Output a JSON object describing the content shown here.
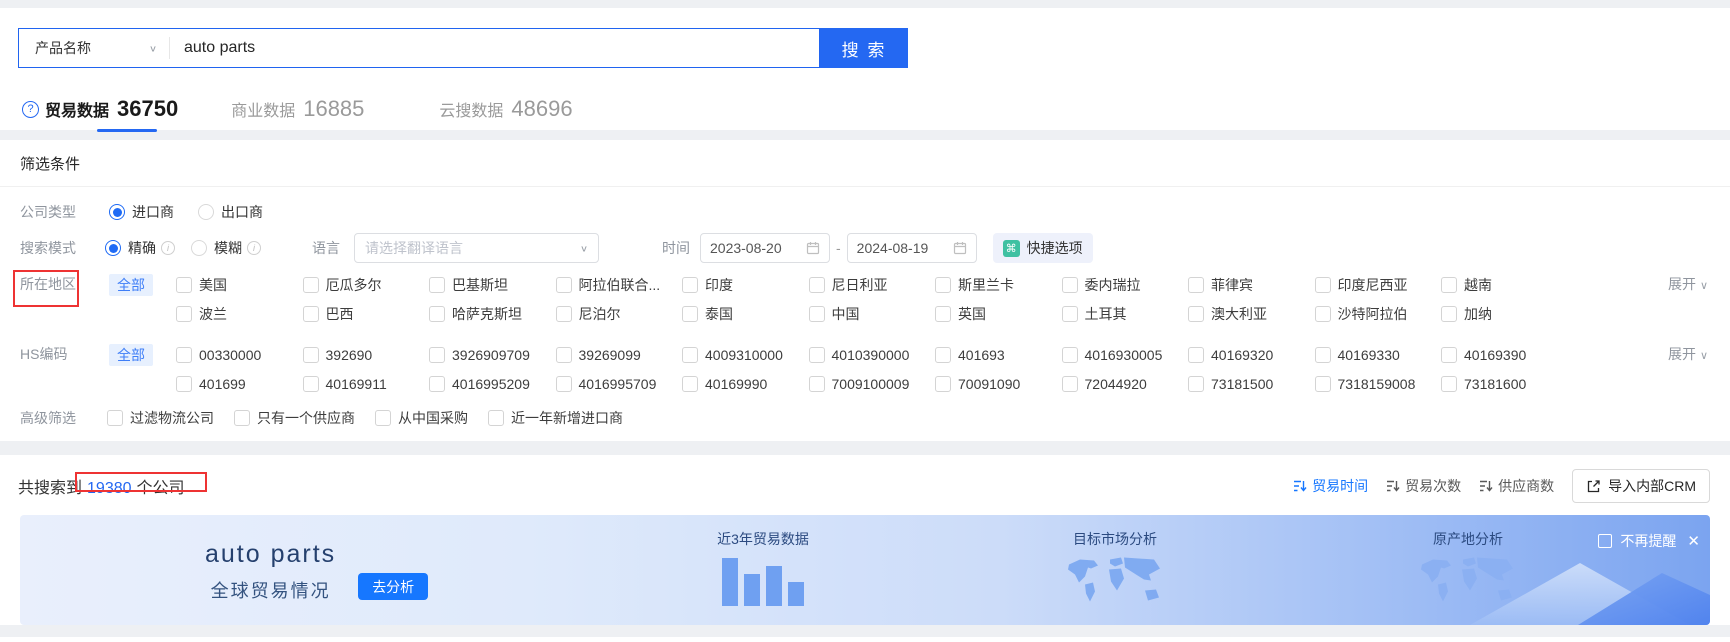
{
  "icons": {
    "help": "?",
    "chevron": "∨",
    "info": "i",
    "command": "⌘",
    "dash": "-",
    "close": "✕"
  },
  "search": {
    "category": "产品名称",
    "query": "auto parts",
    "button": "搜 索"
  },
  "tabs": [
    {
      "label": "贸易数据",
      "count": "36750"
    },
    {
      "label": "商业数据",
      "count": "16885"
    },
    {
      "label": "云搜数据",
      "count": "48696"
    }
  ],
  "filters": {
    "title": "筛选条件",
    "company_type": {
      "label": "公司类型",
      "options": [
        "进口商",
        "出口商"
      ],
      "selected": "进口商"
    },
    "search_mode": {
      "label": "搜索模式",
      "options": [
        "精确",
        "模糊"
      ],
      "selected": "精确"
    },
    "language": {
      "label": "语言",
      "placeholder": "请选择翻译语言"
    },
    "time": {
      "label": "时间",
      "start": "2023-08-20",
      "end": "2024-08-19"
    },
    "quick_option": "快捷选项",
    "region": {
      "label": "所在地区",
      "all": "全部",
      "expand": "展开",
      "row1": [
        "美国",
        "厄瓜多尔",
        "巴基斯坦",
        "阿拉伯联合...",
        "印度",
        "尼日利亚",
        "斯里兰卡",
        "委内瑞拉",
        "菲律宾",
        "印度尼西亚",
        "越南"
      ],
      "row2": [
        "波兰",
        "巴西",
        "哈萨克斯坦",
        "尼泊尔",
        "泰国",
        "中国",
        "英国",
        "土耳其",
        "澳大利亚",
        "沙特阿拉伯",
        "加纳"
      ]
    },
    "hs_code": {
      "label": "HS编码",
      "all": "全部",
      "expand": "展开",
      "row1": [
        "00330000",
        "392690",
        "3926909709",
        "39269099",
        "4009310000",
        "4010390000",
        "401693",
        "4016930005",
        "40169320",
        "40169330",
        "40169390"
      ],
      "row2": [
        "401699",
        "40169911",
        "4016995209",
        "4016995709",
        "40169990",
        "7009100009",
        "70091090",
        "72044920",
        "73181500",
        "7318159008",
        "73181600"
      ]
    },
    "advanced": {
      "label": "高级筛选",
      "options": [
        "过滤物流公司",
        "只有一个供应商",
        "从中国采购",
        "近一年新增进口商"
      ]
    }
  },
  "results": {
    "prefix": "共搜索到",
    "count": "19380",
    "suffix": "个公司",
    "sorts": [
      {
        "label": "贸易时间",
        "active": true
      },
      {
        "label": "贸易次数",
        "active": false
      },
      {
        "label": "供应商数",
        "active": false
      }
    ],
    "crm_button": "导入内部CRM"
  },
  "banner": {
    "title": "auto parts",
    "subtitle": "全球贸易情况",
    "analyze": "去分析",
    "sections": [
      "近3年贸易数据",
      "目标市场分析",
      "原产地分析"
    ],
    "chart_bars": [
      48,
      32,
      40,
      24
    ],
    "dismiss": "不再提醒"
  },
  "colors": {
    "primary": "#2468f2",
    "active_sort": "#1677ff",
    "quick_icon": "#3fc1a2",
    "annotation": "#e23333"
  }
}
